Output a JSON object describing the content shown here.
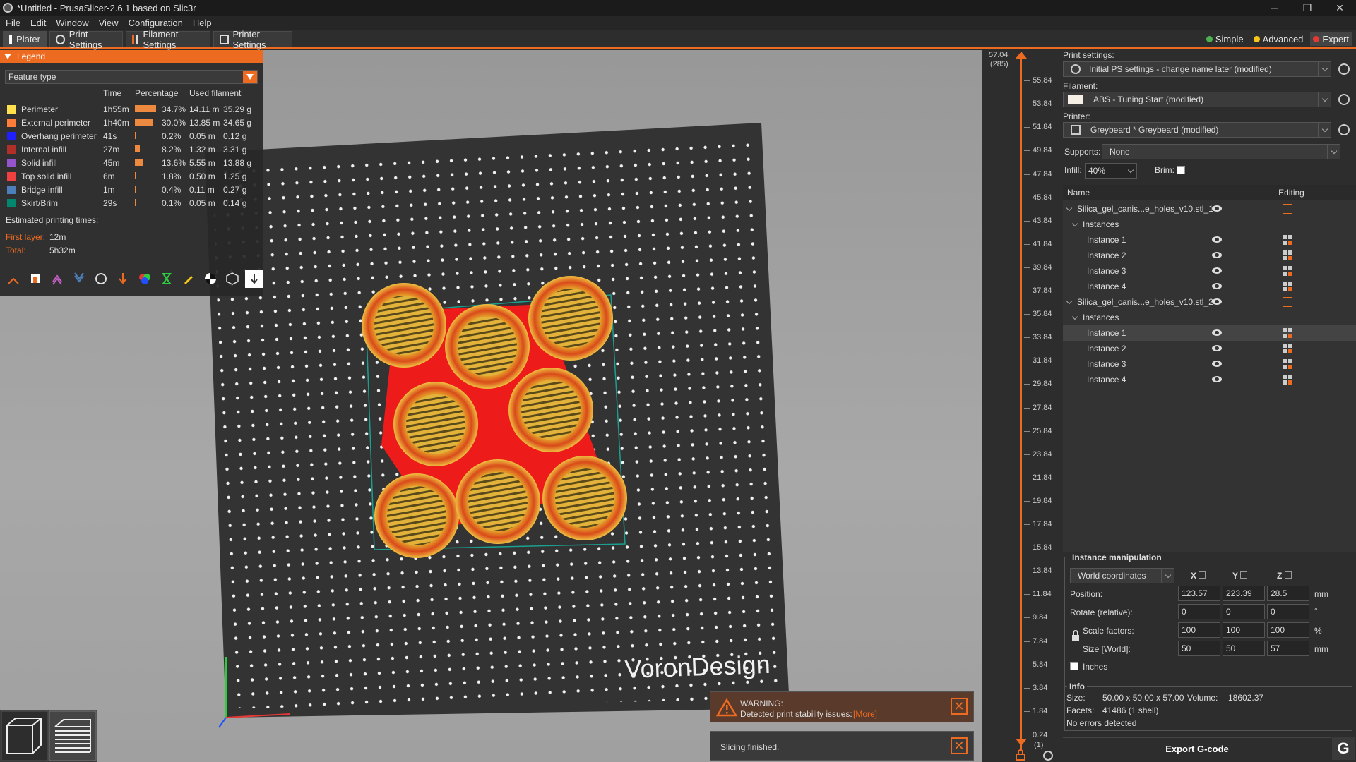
{
  "window": {
    "title": "*Untitled - PrusaSlicer-2.6.1 based on Slic3r",
    "minimize": "─",
    "restore": "❐",
    "close": "✕"
  },
  "menu": [
    "File",
    "Edit",
    "Window",
    "View",
    "Configuration",
    "Help"
  ],
  "tabs": [
    {
      "label": "Plater"
    },
    {
      "label": "Print Settings"
    },
    {
      "label": "Filament Settings"
    },
    {
      "label": "Printer Settings"
    }
  ],
  "modes": [
    {
      "label": "Simple",
      "color": "#4caf50"
    },
    {
      "label": "Advanced",
      "color": "#f5c518"
    },
    {
      "label": "Expert",
      "color": "#e53935"
    }
  ],
  "legend": {
    "title": "Legend",
    "view_type": "Feature type",
    "headers": {
      "time": "Time",
      "percentage": "Percentage",
      "used": "Used filament"
    },
    "rows": [
      {
        "name": "Perimeter",
        "color": "#ffe14d",
        "time": "1h55m",
        "pct": "34.7%",
        "pct_value": 34.7,
        "len": "14.11 m",
        "weight": "35.29 g"
      },
      {
        "name": "External perimeter",
        "color": "#ff7d38",
        "time": "1h40m",
        "pct": "30.0%",
        "pct_value": 30.0,
        "len": "13.85 m",
        "weight": "34.65 g"
      },
      {
        "name": "Overhang perimeter",
        "color": "#1f1fff",
        "time": "41s",
        "pct": "0.2%",
        "pct_value": 0.2,
        "len": "0.05 m",
        "weight": "0.12 g"
      },
      {
        "name": "Internal infill",
        "color": "#b03029",
        "time": "27m",
        "pct": "8.2%",
        "pct_value": 8.2,
        "len": "1.32 m",
        "weight": "3.31 g"
      },
      {
        "name": "Solid infill",
        "color": "#9654cc",
        "time": "45m",
        "pct": "13.6%",
        "pct_value": 13.6,
        "len": "5.55 m",
        "weight": "13.88 g"
      },
      {
        "name": "Top solid infill",
        "color": "#f04040",
        "time": "6m",
        "pct": "1.8%",
        "pct_value": 1.8,
        "len": "0.50 m",
        "weight": "1.25 g"
      },
      {
        "name": "Bridge infill",
        "color": "#4d80ba",
        "time": "1m",
        "pct": "0.4%",
        "pct_value": 0.4,
        "len": "0.11 m",
        "weight": "0.27 g"
      },
      {
        "name": "Skirt/Brim",
        "color": "#00876e",
        "time": "29s",
        "pct": "0.1%",
        "pct_value": 0.1,
        "len": "0.05 m",
        "weight": "0.14 g"
      }
    ],
    "estimated": "Estimated printing times:",
    "first_layer_label": "First layer:",
    "first_layer": "12m",
    "total_label": "Total:",
    "total": "5h32m"
  },
  "viewport": {
    "bed_brand": "VoronDesign"
  },
  "notifications": {
    "warning_title": "WARNING:",
    "warning_text": "Detected print stability issues:",
    "warning_link": "[More]",
    "sliced": "Slicing finished."
  },
  "slider": {
    "top_value": "57.04",
    "top_layer": "(285)",
    "bottom_value": "0.24",
    "bottom_layer": "(1)",
    "ticks": [
      "57.04",
      "55.84",
      "53.84",
      "51.84",
      "49.84",
      "47.84",
      "45.84",
      "43.84",
      "41.84",
      "39.84",
      "37.84",
      "35.84",
      "33.84",
      "31.84",
      "29.84",
      "27.84",
      "25.84",
      "23.84",
      "21.84",
      "19.84",
      "17.84",
      "15.84",
      "13.84",
      "11.84",
      "9.84",
      "7.84",
      "5.84",
      "3.84",
      "1.84",
      "0.24"
    ]
  },
  "panel": {
    "print_label": "Print settings:",
    "print_value": "Initial PS settings - change name later (modified)",
    "filament_label": "Filament:",
    "filament_value": "ABS - Tuning Start (modified)",
    "filament_color": "#f5efe6",
    "printer_label": "Printer:",
    "printer_value": "Greybeard * Greybeard (modified)",
    "supports_label": "Supports:",
    "supports_value": "None",
    "infill_label": "Infill:",
    "infill_value": "40%",
    "brim_label": "Brim:"
  },
  "objects": {
    "col_name": "Name",
    "col_editing": "Editing",
    "rows": [
      {
        "label": "Silica_gel_canis...e_holes_v10.stl_1",
        "level": 0
      },
      {
        "label": "Instances",
        "level": 1
      },
      {
        "label": "Instance 1",
        "level": 2
      },
      {
        "label": "Instance 2",
        "level": 2
      },
      {
        "label": "Instance 3",
        "level": 2
      },
      {
        "label": "Instance 4",
        "level": 2
      },
      {
        "label": "Silica_gel_canis...e_holes_v10.stl_2",
        "level": 0
      },
      {
        "label": "Instances",
        "level": 1
      },
      {
        "label": "Instance 1",
        "level": 2,
        "selected": true
      },
      {
        "label": "Instance 2",
        "level": 2
      },
      {
        "label": "Instance 3",
        "level": 2
      },
      {
        "label": "Instance 4",
        "level": 2
      }
    ]
  },
  "manip": {
    "title": "Instance manipulation",
    "coords": "World coordinates",
    "x": "X",
    "y": "Y",
    "z": "Z",
    "position_label": "Position:",
    "position": [
      "123.57",
      "223.39",
      "28.5"
    ],
    "position_unit": "mm",
    "rotate_label": "Rotate (relative):",
    "rotate": [
      "0",
      "0",
      "0"
    ],
    "rotate_unit": "°",
    "scale_label": "Scale factors:",
    "scale": [
      "100",
      "100",
      "100"
    ],
    "scale_unit": "%",
    "size_label": "Size [World]:",
    "size": [
      "50",
      "50",
      "57"
    ],
    "size_unit": "mm",
    "inches": "Inches"
  },
  "info": {
    "title": "Info",
    "size_label": "Size:",
    "size": "50.00 x 50.00 x 57.00",
    "volume_label": "Volume:",
    "volume": "18602.37",
    "facets_label": "Facets:",
    "facets": "41486 (1 shell)",
    "errors": "No errors detected"
  },
  "export": {
    "label": "Export G-code",
    "g": "G"
  }
}
